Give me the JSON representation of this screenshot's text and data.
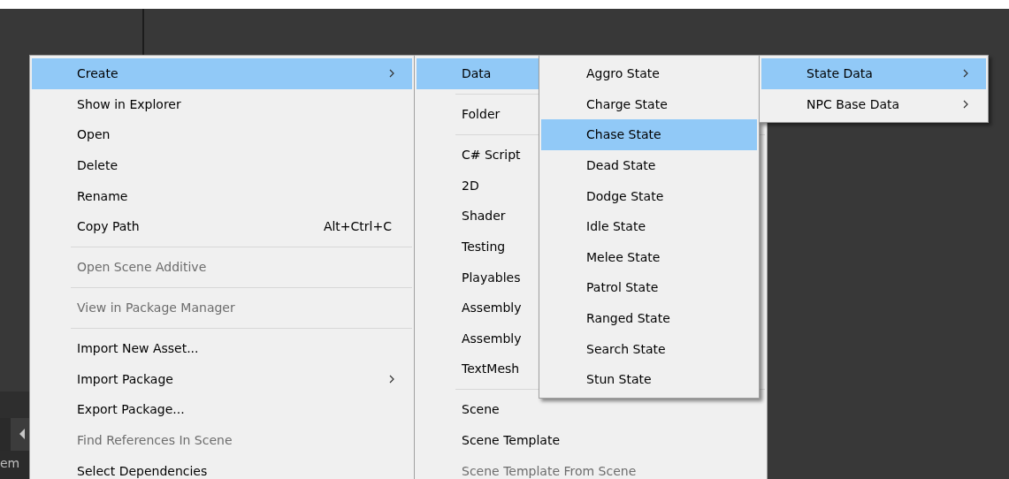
{
  "background": {
    "partial_label": "em"
  },
  "menus": [
    {
      "items": [
        {
          "kind": "item",
          "label": "Create",
          "selected": true,
          "submenu": true,
          "disabled": false
        },
        {
          "kind": "item",
          "label": "Show in Explorer",
          "selected": false,
          "submenu": false,
          "disabled": false
        },
        {
          "kind": "item",
          "label": "Open",
          "selected": false,
          "submenu": false,
          "disabled": false
        },
        {
          "kind": "item",
          "label": "Delete",
          "selected": false,
          "submenu": false,
          "disabled": false
        },
        {
          "kind": "item",
          "label": "Rename",
          "selected": false,
          "submenu": false,
          "disabled": false
        },
        {
          "kind": "item",
          "label": "Copy Path",
          "shortcut": "Alt+Ctrl+C",
          "selected": false,
          "submenu": false,
          "disabled": false
        },
        {
          "kind": "separator"
        },
        {
          "kind": "item",
          "label": "Open Scene Additive",
          "selected": false,
          "submenu": false,
          "disabled": true
        },
        {
          "kind": "separator"
        },
        {
          "kind": "item",
          "label": "View in Package Manager",
          "selected": false,
          "submenu": false,
          "disabled": true
        },
        {
          "kind": "separator"
        },
        {
          "kind": "item",
          "label": "Import New Asset...",
          "selected": false,
          "submenu": false,
          "disabled": false
        },
        {
          "kind": "item",
          "label": "Import Package",
          "selected": false,
          "submenu": true,
          "disabled": false
        },
        {
          "kind": "item",
          "label": "Export Package...",
          "selected": false,
          "submenu": false,
          "disabled": false
        },
        {
          "kind": "item",
          "label": "Find References In Scene",
          "selected": false,
          "submenu": false,
          "disabled": true
        },
        {
          "kind": "item",
          "label": "Select Dependencies",
          "selected": false,
          "submenu": false,
          "disabled": false
        }
      ]
    },
    {
      "items": [
        {
          "kind": "item",
          "label": "Data",
          "selected": true,
          "submenu": false,
          "disabled": false
        },
        {
          "kind": "separator"
        },
        {
          "kind": "item",
          "label": "Folder",
          "selected": false,
          "submenu": false,
          "disabled": false
        },
        {
          "kind": "separator"
        },
        {
          "kind": "item",
          "label": "C# Script",
          "selected": false,
          "submenu": false,
          "disabled": false
        },
        {
          "kind": "item",
          "label": "2D",
          "selected": false,
          "submenu": false,
          "disabled": false
        },
        {
          "kind": "item",
          "label": "Shader",
          "selected": false,
          "submenu": false,
          "disabled": false
        },
        {
          "kind": "item",
          "label": "Testing",
          "selected": false,
          "submenu": false,
          "disabled": false
        },
        {
          "kind": "item",
          "label": "Playables",
          "selected": false,
          "submenu": false,
          "disabled": false
        },
        {
          "kind": "item",
          "label": "Assembly",
          "selected": false,
          "submenu": false,
          "disabled": false
        },
        {
          "kind": "item",
          "label": "Assembly",
          "selected": false,
          "submenu": false,
          "disabled": false
        },
        {
          "kind": "item",
          "label": "TextMesh",
          "selected": false,
          "submenu": false,
          "disabled": false
        },
        {
          "kind": "separator"
        },
        {
          "kind": "item",
          "label": "Scene",
          "selected": false,
          "submenu": false,
          "disabled": false
        },
        {
          "kind": "item",
          "label": "Scene Template",
          "selected": false,
          "submenu": false,
          "disabled": false
        },
        {
          "kind": "item",
          "label": "Scene Template From Scene",
          "selected": false,
          "submenu": false,
          "disabled": true
        }
      ]
    },
    {
      "items": [
        {
          "kind": "item",
          "label": "Aggro State",
          "selected": false,
          "submenu": false,
          "disabled": false
        },
        {
          "kind": "item",
          "label": "Charge State",
          "selected": false,
          "submenu": false,
          "disabled": false
        },
        {
          "kind": "item",
          "label": "Chase State",
          "selected": true,
          "submenu": false,
          "disabled": false
        },
        {
          "kind": "item",
          "label": "Dead State",
          "selected": false,
          "submenu": false,
          "disabled": false
        },
        {
          "kind": "item",
          "label": "Dodge State",
          "selected": false,
          "submenu": false,
          "disabled": false
        },
        {
          "kind": "item",
          "label": "Idle State",
          "selected": false,
          "submenu": false,
          "disabled": false
        },
        {
          "kind": "item",
          "label": "Melee State",
          "selected": false,
          "submenu": false,
          "disabled": false
        },
        {
          "kind": "item",
          "label": "Patrol State",
          "selected": false,
          "submenu": false,
          "disabled": false
        },
        {
          "kind": "item",
          "label": "Ranged State",
          "selected": false,
          "submenu": false,
          "disabled": false
        },
        {
          "kind": "item",
          "label": "Search State",
          "selected": false,
          "submenu": false,
          "disabled": false
        },
        {
          "kind": "item",
          "label": "Stun State",
          "selected": false,
          "submenu": false,
          "disabled": false
        }
      ]
    },
    {
      "items": [
        {
          "kind": "item",
          "label": "State Data",
          "selected": true,
          "submenu": true,
          "disabled": false
        },
        {
          "kind": "item",
          "label": "NPC Base Data",
          "selected": false,
          "submenu": true,
          "disabled": false
        }
      ]
    }
  ]
}
